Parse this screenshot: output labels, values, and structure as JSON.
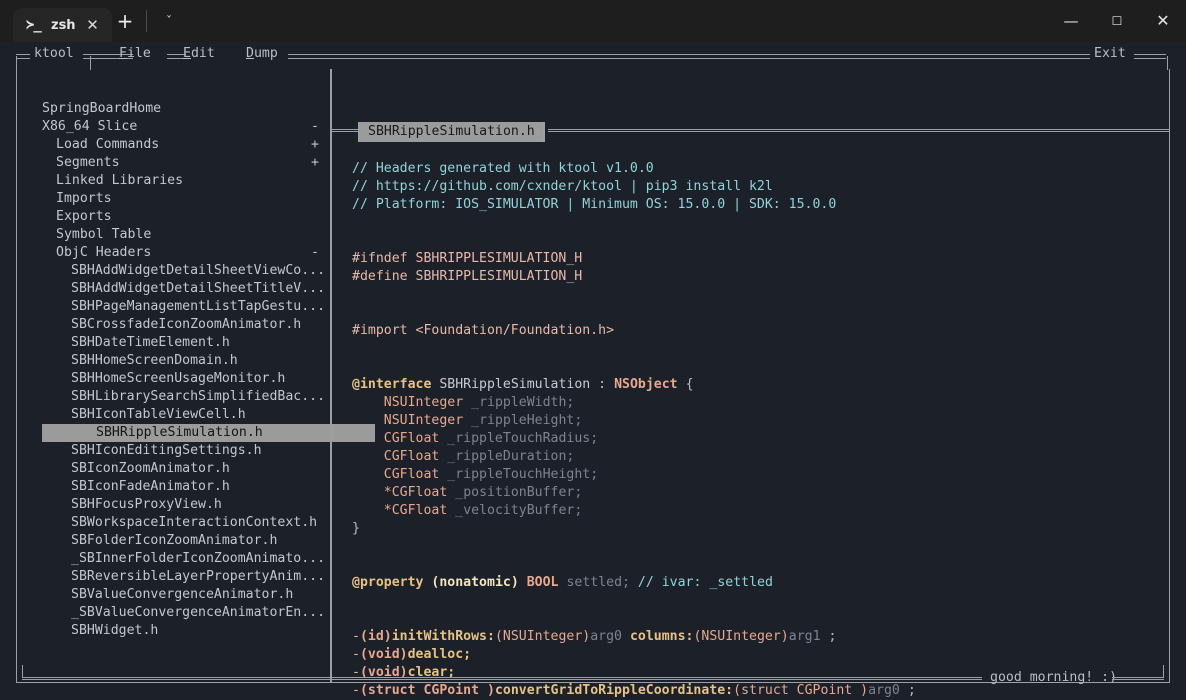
{
  "window": {
    "tab": {
      "icon": "terminal-prompt-icon",
      "icon_glyph": "≻_",
      "label": "zsh",
      "close_glyph": "✕"
    },
    "new_tab_glyph": "+",
    "dropdown_glyph": "ˇ",
    "controls": {
      "minimize": "—",
      "maximize": "☐",
      "close": "✕"
    }
  },
  "menubar": {
    "app": "ktool",
    "items": [
      {
        "label": "File",
        "accel": "F"
      },
      {
        "label": "Edit",
        "accel": "E"
      },
      {
        "label": "Dump",
        "accel": "D"
      }
    ],
    "exit": "Exit"
  },
  "sidebar": {
    "items": [
      {
        "label": "SpringBoardHome",
        "indent": 0,
        "mark": ""
      },
      {
        "label": "X86_64 Slice",
        "indent": 0,
        "mark": "-"
      },
      {
        "label": "Load Commands",
        "indent": 1,
        "mark": "+"
      },
      {
        "label": "Segments",
        "indent": 1,
        "mark": "+"
      },
      {
        "label": "Linked Libraries",
        "indent": 1,
        "mark": ""
      },
      {
        "label": "Imports",
        "indent": 1,
        "mark": ""
      },
      {
        "label": "Exports",
        "indent": 1,
        "mark": ""
      },
      {
        "label": "Symbol Table",
        "indent": 1,
        "mark": ""
      },
      {
        "label": "ObjC Headers",
        "indent": 1,
        "mark": "-"
      },
      {
        "label": "SBHAddWidgetDetailSheetViewCo...",
        "indent": 2,
        "mark": ""
      },
      {
        "label": "SBHAddWidgetDetailSheetTitleV...",
        "indent": 2,
        "mark": ""
      },
      {
        "label": "SBHPageManagementListTapGestu...",
        "indent": 2,
        "mark": ""
      },
      {
        "label": "SBCrossfadeIconZoomAnimator.h",
        "indent": 2,
        "mark": ""
      },
      {
        "label": "SBHDateTimeElement.h",
        "indent": 2,
        "mark": ""
      },
      {
        "label": "SBHHomeScreenDomain.h",
        "indent": 2,
        "mark": ""
      },
      {
        "label": "SBHHomeScreenUsageMonitor.h",
        "indent": 2,
        "mark": ""
      },
      {
        "label": "SBHLibrarySearchSimplifiedBac...",
        "indent": 2,
        "mark": ""
      },
      {
        "label": "SBHIconTableViewCell.h",
        "indent": 2,
        "mark": ""
      },
      {
        "label": "SBHRippleSimulation.h",
        "indent": 2,
        "mark": "",
        "selected": true
      },
      {
        "label": "SBHIconEditingSettings.h",
        "indent": 2,
        "mark": ""
      },
      {
        "label": "SBIconZoomAnimator.h",
        "indent": 2,
        "mark": ""
      },
      {
        "label": "SBIconFadeAnimator.h",
        "indent": 2,
        "mark": ""
      },
      {
        "label": "SBHFocusProxyView.h",
        "indent": 2,
        "mark": ""
      },
      {
        "label": "SBWorkspaceInteractionContext.h",
        "indent": 2,
        "mark": ""
      },
      {
        "label": "SBFolderIconZoomAnimator.h",
        "indent": 2,
        "mark": ""
      },
      {
        "label": "_SBInnerFolderIconZoomAnimato...",
        "indent": 2,
        "mark": ""
      },
      {
        "label": "SBReversibleLayerPropertyAnim...",
        "indent": 2,
        "mark": ""
      },
      {
        "label": "SBValueConvergenceAnimator.h",
        "indent": 2,
        "mark": ""
      },
      {
        "label": "_SBValueConvergenceAnimatorEn...",
        "indent": 2,
        "mark": ""
      },
      {
        "label": "SBHWidget.h",
        "indent": 2,
        "mark": ""
      }
    ]
  },
  "editor": {
    "tab_title": "SBHRippleSimulation.h",
    "lines": {
      "c1": "// Headers generated with ktool v1.0.0",
      "c2": "// https://github.com/cxnder/ktool | pip3 install k2l",
      "c3": "// Platform: IOS_SIMULATOR | Minimum OS: 15.0.0 | SDK: 15.0.0",
      "ifndef": "#ifndef SBHRIPPLESIMULATION_H",
      "define": "#define SBHRIPPLESIMULATION_H",
      "import": "#import <Foundation/Foundation.h>",
      "iface_kw": "@interface",
      "iface_name": "SBHRippleSimulation",
      "iface_colon": ":",
      "iface_super": "NSObject",
      "iface_brace": "{",
      "ivars": [
        {
          "type": "NSUInteger",
          "name": "_rippleWidth;"
        },
        {
          "type": "NSUInteger",
          "name": "_rippleHeight;"
        },
        {
          "type": "CGFloat",
          "name": "_rippleTouchRadius;"
        },
        {
          "type": "CGFloat",
          "name": "_rippleDuration;"
        },
        {
          "type": "CGFloat",
          "name": "_rippleTouchHeight;"
        },
        {
          "type": "*CGFloat",
          "name": "_positionBuffer;"
        },
        {
          "type": "*CGFloat",
          "name": "_velocityBuffer;"
        }
      ],
      "close_brace": "}",
      "prop_kw": "@property",
      "prop_attrs": "(nonatomic)",
      "prop_type": "BOOL",
      "prop_name": "settled;",
      "prop_comment": "// ivar: _settled",
      "methods": [
        {
          "dash": "-",
          "ret": "(id)",
          "sel": "initWithRows:",
          "argt": "(NSUInteger)",
          "arg": "arg0",
          "sel2": "columns:",
          "argt2": "(NSUInteger)",
          "arg2": "arg1",
          "end": ";"
        },
        {
          "dash": "-",
          "ret": "(void)",
          "sel": "dealloc;",
          "argt": "",
          "arg": "",
          "sel2": "",
          "argt2": "",
          "arg2": "",
          "end": ""
        },
        {
          "dash": "-",
          "ret": "(void)",
          "sel": "clear;",
          "argt": "",
          "arg": "",
          "sel2": "",
          "argt2": "",
          "arg2": "",
          "end": ""
        },
        {
          "dash": "-",
          "ret": "(struct CGPoint )",
          "sel": "convertGridToRippleCoordinate:",
          "argt": "(struct CGPoint )",
          "arg": "arg0",
          "sel2": "",
          "argt2": "",
          "arg2": "",
          "end": ";"
        }
      ]
    }
  },
  "status": {
    "message": "good morning! :)"
  },
  "colors": {
    "background": "#1b2029",
    "titlebar": "#1e1e1e",
    "border": "#9aa0a6",
    "selection": "#9b9b9b",
    "comment": "#8fd4d9",
    "preproc": "#e8b9aa",
    "keyword": "#e6c384",
    "type": "#e8a88f",
    "text": "#c7cbd1",
    "dim": "#7e848d"
  }
}
